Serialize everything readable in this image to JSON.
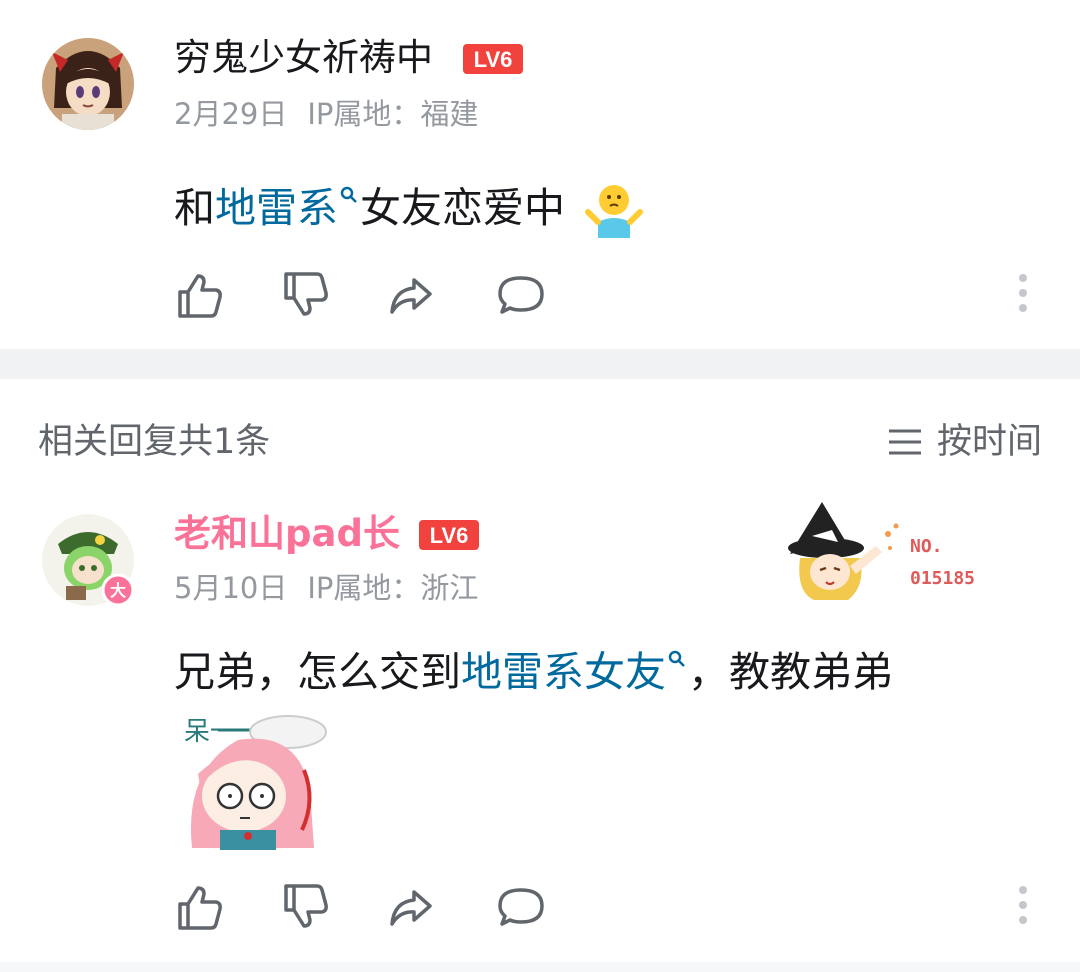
{
  "main_comment": {
    "username": "穷鬼少女祈祷中",
    "level": "LV6",
    "date": "2月29日",
    "ip": "IP属地：福建",
    "text_before": "和",
    "text_link": "地雷系",
    "text_after": "女友恋爱中",
    "emoji": "🤷"
  },
  "related": {
    "title": "相关回复共1条",
    "sort_label": "按时间"
  },
  "reply": {
    "username": "老和山pad长",
    "level": "LV6",
    "badge": "大",
    "date": "5月10日",
    "ip": "IP属地：浙江",
    "text_before": "兄弟，怎么交到",
    "text_link": "地雷系女友",
    "text_after": "，教教弟弟",
    "sticker_caption": "呆一",
    "fan_badge_line1": "NO.",
    "fan_badge_line2": "015185"
  },
  "colors": {
    "link": "#00699d",
    "vip_name": "#fb7299",
    "level_badge": "#f2423d",
    "meta": "#9499a0"
  },
  "icons": [
    "like-icon",
    "dislike-icon",
    "share-icon",
    "comment-icon",
    "more-icon",
    "search-mark-icon",
    "sort-lines-icon"
  ]
}
